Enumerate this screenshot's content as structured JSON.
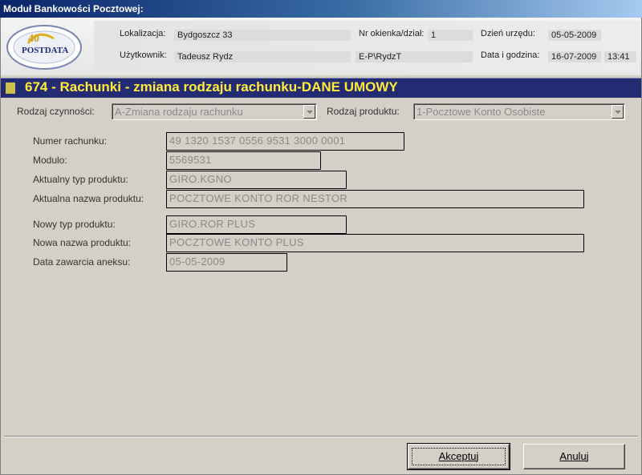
{
  "window": {
    "title": "Moduł Bankowości Pocztowej:"
  },
  "logo": {
    "text": "POSTDATA"
  },
  "header": {
    "location_label": "Lokalizacja:",
    "location_value": "Bydgoszcz 33",
    "user_label": "Użytkownik:",
    "user_value": "Tadeusz Rydz",
    "window_label": "Nr okienka/dział:",
    "window_value": "1",
    "login_value": "E-P\\RydzT",
    "office_day_label": "Dzień urzędu:",
    "office_day_value": "05-05-2009",
    "datetime_label": "Data i godzina:",
    "date_value": "16-07-2009",
    "time_value": "13:41"
  },
  "banner": {
    "title": "674 - Rachunki - zmiana rodzaju rachunku-DANE UMOWY"
  },
  "filters": {
    "action_label": "Rodzaj czynności:",
    "action_value": "A-Zmiana rodzaju rachunku",
    "product_label": "Rodzaj produktu:",
    "product_value": "1-Pocztowe Konto Osobiste"
  },
  "form": {
    "account_number_label": "Numer rachunku:",
    "account_number_value": "49 1320 1537 0556 9531 3000 0001",
    "modulo_label": "Modulo:",
    "modulo_value": "5569531",
    "current_type_label": "Aktualny typ produktu:",
    "current_type_value": "GIRO.KGNO",
    "current_name_label": "Aktualna nazwa produktu:",
    "current_name_value": "POCZTOWE KONTO ROR NESTOR",
    "new_type_label": "Nowy typ produktu:",
    "new_type_value": "GIRO.ROR PLUS",
    "new_name_label": "Nowa nazwa produktu:",
    "new_name_value": "POCZTOWE KONTO PLUS",
    "annex_date_label": "Data zawarcia aneksu:",
    "annex_date_value": "05-05-2009"
  },
  "buttons": {
    "accept": "Akceptuj",
    "cancel": "Anuluj"
  },
  "colors": {
    "banner_bg": "#232b73",
    "banner_text": "#ffeb3b",
    "title_bar": "#0a246a"
  }
}
